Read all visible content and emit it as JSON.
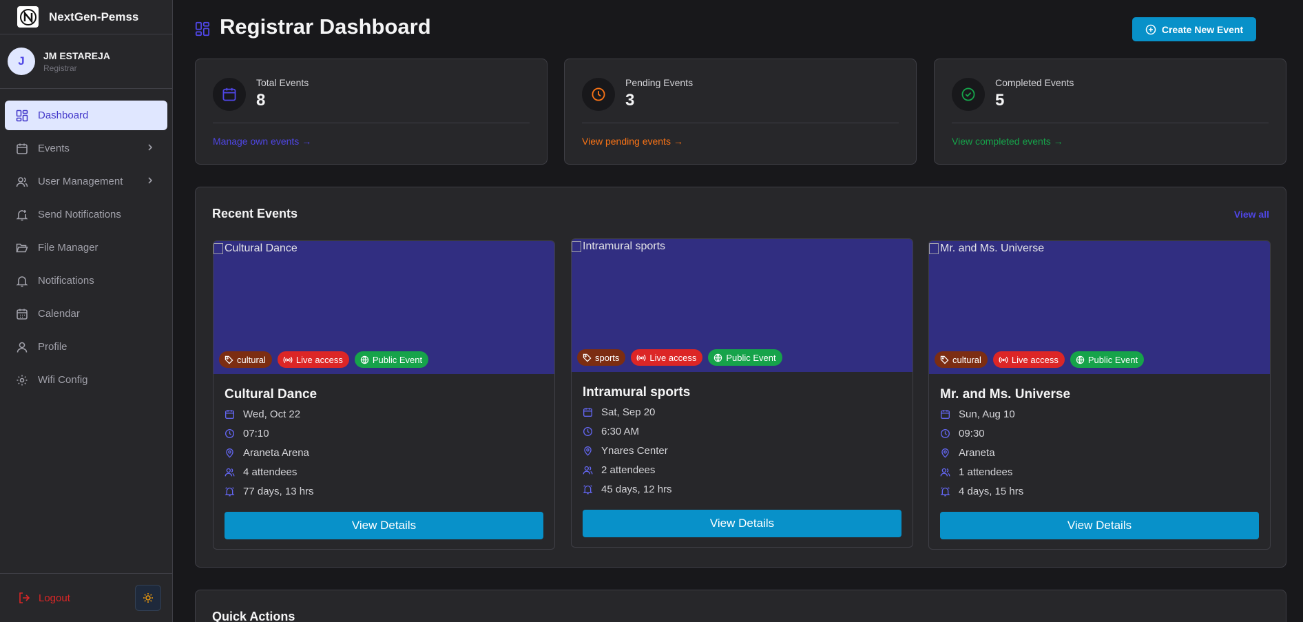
{
  "sidebar": {
    "brand": "NextGen-Pemss",
    "user": {
      "initial": "J",
      "name": "JM ESTAREJA",
      "role": "Registrar"
    },
    "items": [
      {
        "label": "Dashboard",
        "icon": "dashboard-icon",
        "active": true
      },
      {
        "label": "Events",
        "icon": "calendar-icon",
        "has_submenu": true
      },
      {
        "label": "User Management",
        "icon": "users-icon",
        "has_submenu": true
      },
      {
        "label": "Send Notifications",
        "icon": "bell-plus-icon"
      },
      {
        "label": "File Manager",
        "icon": "folder-open-icon"
      },
      {
        "label": "Notifications",
        "icon": "bell-icon"
      },
      {
        "label": "Calendar",
        "icon": "calendar-days-icon"
      },
      {
        "label": "Profile",
        "icon": "user-icon"
      },
      {
        "label": "Wifi Config",
        "icon": "gear-icon"
      }
    ],
    "logout_label": "Logout"
  },
  "header": {
    "title": "Registrar Dashboard",
    "create_label": "Create New Event"
  },
  "stats": [
    {
      "label": "Total Events",
      "value": "8",
      "link": "Manage own events",
      "color": "#4f46e5"
    },
    {
      "label": "Pending Events",
      "value": "3",
      "link": "View pending events",
      "color": "#f97316"
    },
    {
      "label": "Completed Events",
      "value": "5",
      "link": "View completed events",
      "color": "#16a34a"
    }
  ],
  "recent": {
    "title": "Recent Events",
    "view_all": "View all",
    "events": [
      {
        "img_alt": "Cultural Dance",
        "category": "cultural",
        "live": "Live access",
        "public": "Public Event",
        "title": "Cultural Dance",
        "date": "Wed, Oct 22",
        "time": "07:10",
        "location": "Araneta Arena",
        "attendees": "4 attendees",
        "countdown": "77 days, 13 hrs",
        "button": "View Details"
      },
      {
        "img_alt": "Intramural sports",
        "category": "sports",
        "live": "Live access",
        "public": "Public Event",
        "title": "Intramural sports",
        "date": "Sat, Sep 20",
        "time": "6:30 AM",
        "location": "Ynares Center",
        "attendees": "2 attendees",
        "countdown": "45 days, 12 hrs",
        "button": "View Details"
      },
      {
        "img_alt": "Mr. and Ms. Universe",
        "category": "cultural",
        "live": "Live access",
        "public": "Public Event",
        "title": "Mr. and Ms. Universe",
        "date": "Sun, Aug 10",
        "time": "09:30",
        "location": "Araneta",
        "attendees": "1 attendees",
        "countdown": "4 days, 15 hrs",
        "button": "View Details"
      }
    ]
  },
  "quick_actions": {
    "title": "Quick Actions"
  },
  "colors": {
    "accent": "#0891c9",
    "brand_indigo": "#4f46e5",
    "image_placeholder": "#312e81"
  }
}
